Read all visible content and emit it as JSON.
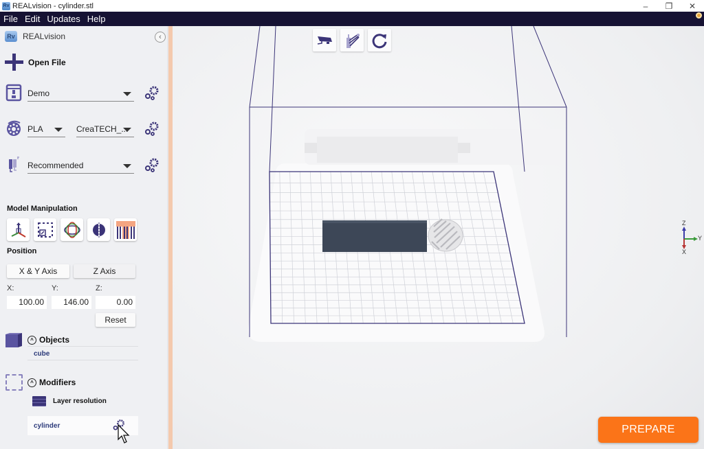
{
  "window": {
    "title": "REALvision - cylinder.stl",
    "app_icon": "Rv",
    "controls": {
      "minimize": "–",
      "maximize": "❐",
      "close": "✕"
    }
  },
  "menubar": {
    "items": [
      "File",
      "Edit",
      "Updates",
      "Help"
    ],
    "notification_icon": "notification-dot-icon"
  },
  "sidebar": {
    "brand": {
      "logo": "Rv",
      "name": "REALvision"
    },
    "collapse_glyph": "‹",
    "open_file_label": "Open File",
    "printer": {
      "selected": "Demo"
    },
    "material": {
      "type": "PLA",
      "profile": "CreaTECH_..."
    },
    "print_settings": {
      "selected": "Recommended"
    },
    "model_manipulation": {
      "title": "Model Manipulation",
      "tools": [
        "move-tool",
        "scale-tool",
        "rotate-tool",
        "mirror-tool",
        "cut-tool"
      ]
    },
    "position": {
      "title": "Position",
      "xy_button": "X & Y Axis",
      "z_button": "Z Axis",
      "labels": {
        "x": "X:",
        "y": "Y:",
        "z": "Z:"
      },
      "values": {
        "x": "100.00",
        "y": "146.00",
        "z": "0.00"
      },
      "reset_label": "Reset"
    },
    "objects": {
      "title": "Objects",
      "items": [
        "cube"
      ]
    },
    "modifiers": {
      "title": "Modifiers",
      "group_label": "Layer resolution",
      "items": [
        "cylinder"
      ]
    }
  },
  "viewport": {
    "tools": [
      "camera-view",
      "lighting",
      "reset-view"
    ],
    "axes": {
      "z": "Z",
      "y": "Y",
      "x": "X"
    },
    "colors": {
      "cube": "#3d4757",
      "frame": "#3b3478"
    }
  },
  "prepare_label": "PREPARE",
  "colors": {
    "accent": "#fb7418",
    "menubar": "#161233",
    "icon": "#3b3478",
    "sidebar_edge": "#f4c9ad"
  }
}
